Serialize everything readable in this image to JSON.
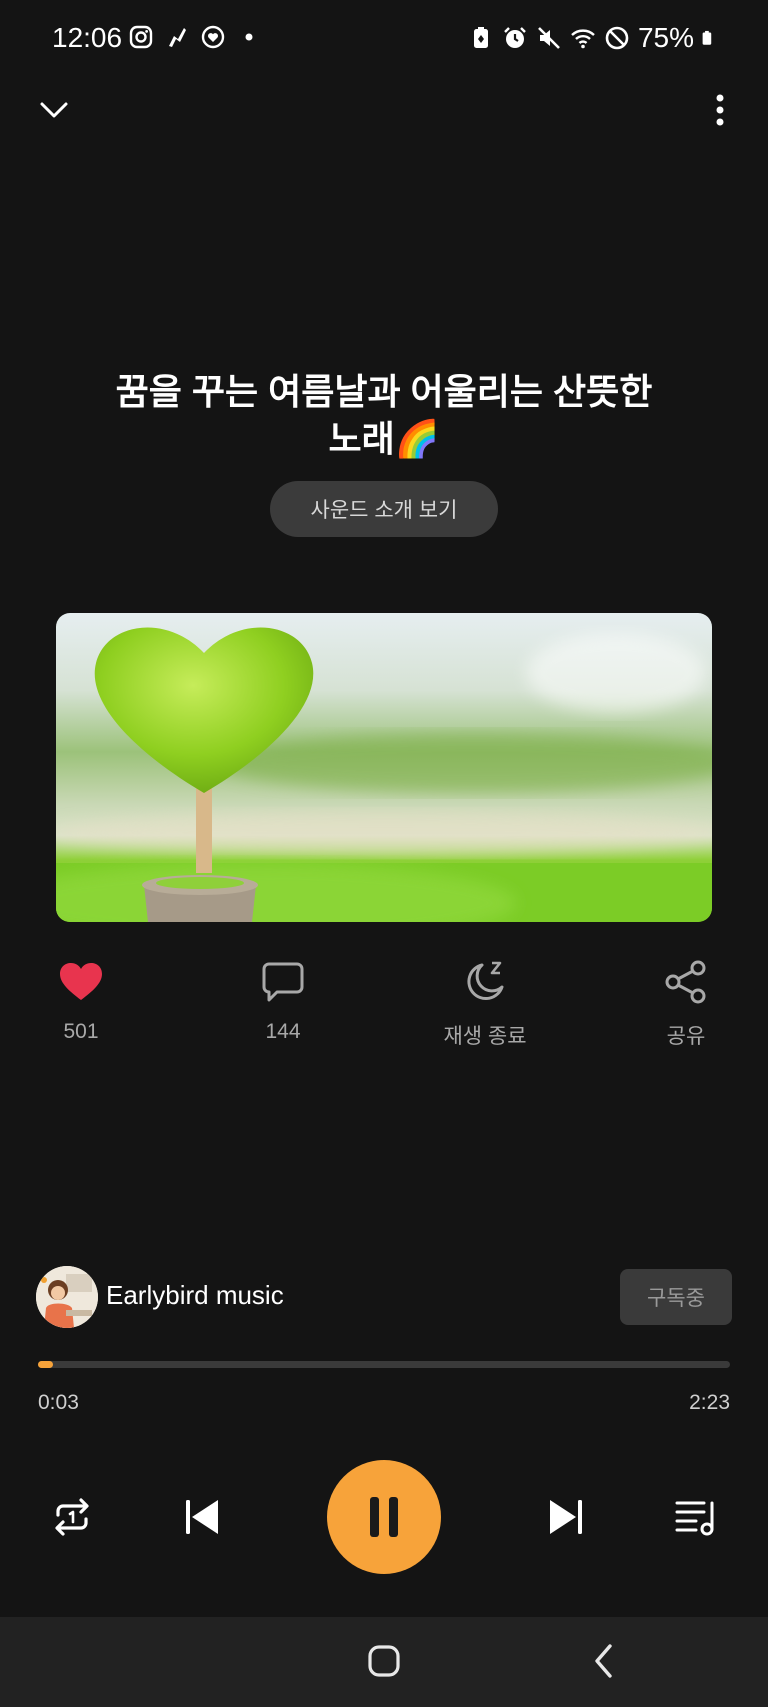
{
  "status_bar": {
    "time": "12:06",
    "battery": "75%",
    "left_icons": [
      "instagram-icon",
      "app-notification-icon",
      "heart-app-icon",
      "dot-icon"
    ],
    "right_icons": [
      "battery-saver-icon",
      "alarm-icon",
      "mute-icon",
      "wifi-icon",
      "do-not-disturb-icon",
      "battery-icon"
    ]
  },
  "header": {
    "collapse_icon": "chevron-down-icon",
    "more_icon": "more-vertical-icon"
  },
  "sound": {
    "title_line1": "꿈을 꾸는 여름날과 어울리는 산뜻한",
    "title_line2": "노래🌈",
    "intro_button": "사운드 소개 보기"
  },
  "actions": {
    "like_count": "501",
    "comment_count": "144",
    "sleep_label": "재생 종료",
    "share_label": "공유"
  },
  "channel": {
    "name": "Earlybird music",
    "subscribe_label": "구독중"
  },
  "player": {
    "current_time": "0:03",
    "total_time": "2:23",
    "progress": 0.021,
    "accent_color": "#f7a33a",
    "like_color": "#e8344e"
  },
  "nav": {
    "home_icon": "home-icon",
    "back_icon": "back-icon"
  }
}
